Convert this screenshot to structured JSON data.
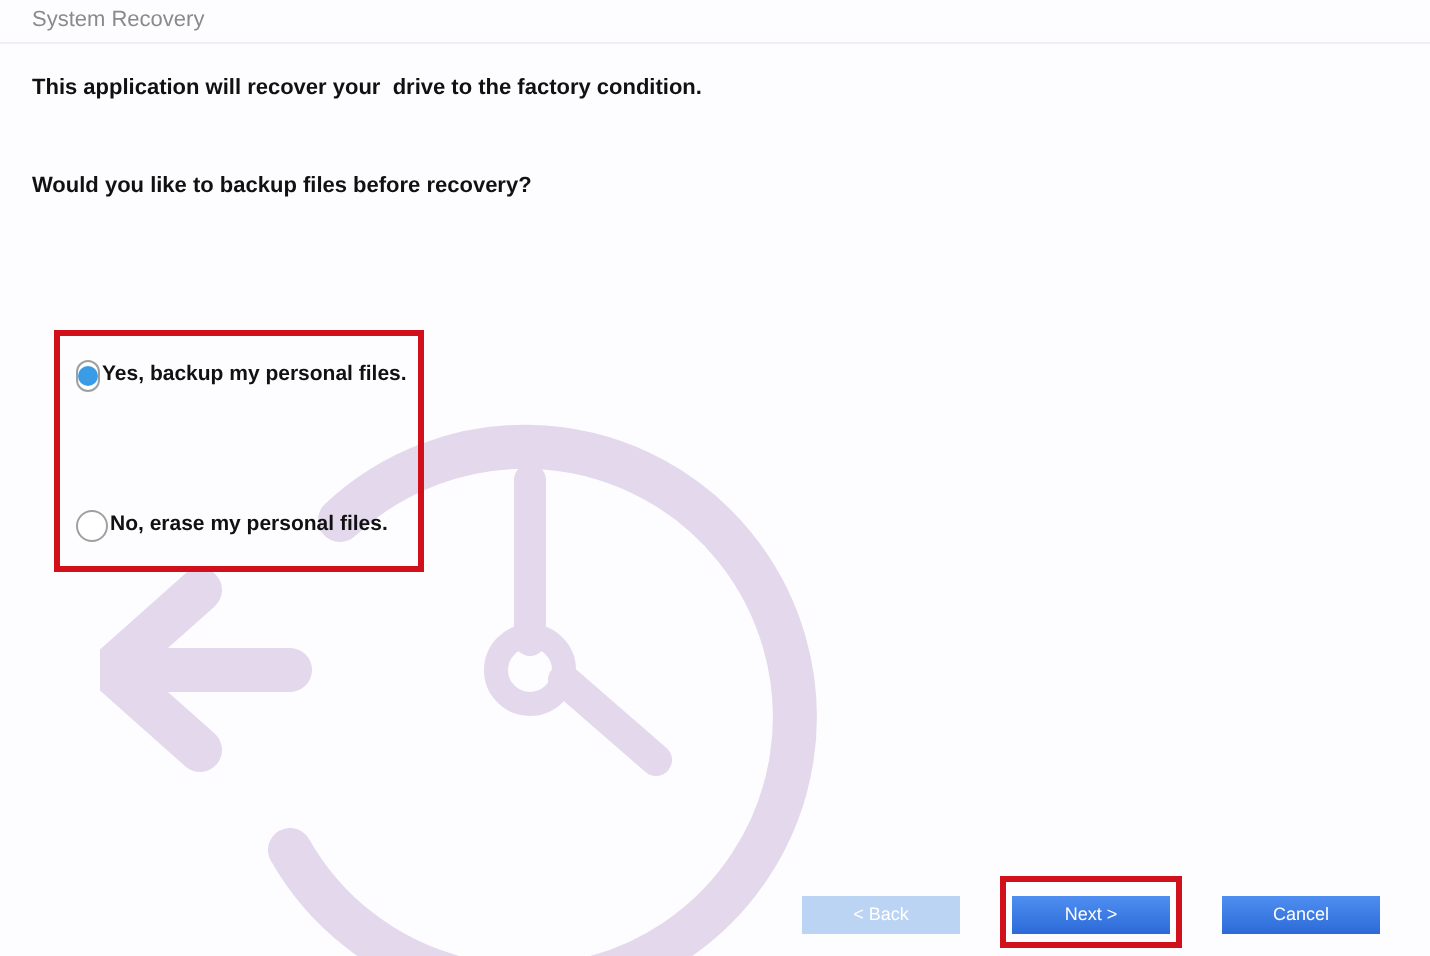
{
  "window": {
    "title": "System Recovery"
  },
  "intro": "This application will recover your  drive to the factory condition.",
  "question": "Would you like to backup files before recovery?",
  "options_group": {
    "highlighted": true
  },
  "options": [
    {
      "label": "Yes, backup my personal files.",
      "selected": true
    },
    {
      "label": "No, erase my personal files.",
      "selected": false
    }
  ],
  "buttons": [
    {
      "label": "< Back",
      "disabled": true,
      "highlighted": false
    },
    {
      "label": "Next >",
      "disabled": false,
      "highlighted": true
    },
    {
      "label": "Cancel",
      "disabled": false,
      "highlighted": false
    }
  ]
}
